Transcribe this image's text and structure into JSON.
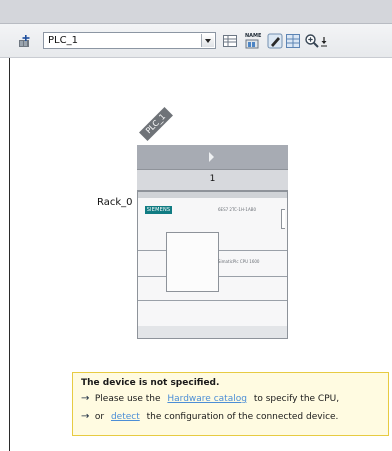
{
  "toolbar": {
    "device_select_value": "PLC_1",
    "icons": {
      "device_view": "network-device-icon",
      "device_select_arrow": "chevron-down-icon",
      "table": "table-view-icon",
      "name": "show-module-names-icon",
      "name_text": "NAME",
      "properties": "properties-icon",
      "grid": "grid-icon",
      "zoom": "zoom-icon",
      "zoom_menu": "zoom-menu-arrow-icon"
    }
  },
  "diagram": {
    "device_label": "PLC_1",
    "rack_label": "Rack_0",
    "slot_number": "1",
    "module_badge": "SIEMENS",
    "module_code": "6ES7 2TC-1H-1AB0",
    "module_name": "SimaticPlc CPU 1600"
  },
  "info_box": {
    "title": "The device is not specified.",
    "line1_prefix": "Please use the",
    "line1_link": "Hardware catalog",
    "line1_suffix": "to specify the CPU,",
    "line2_prefix": "or",
    "line2_link": "detect",
    "line2_suffix": "the configuration of the connected device."
  }
}
